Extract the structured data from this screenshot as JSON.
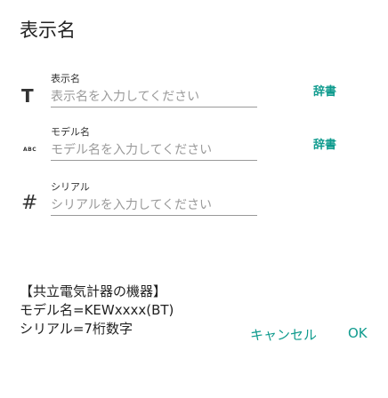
{
  "dialog": {
    "title": "表示名"
  },
  "fields": [
    {
      "icon": "text-format-icon",
      "icon_glyph": "T",
      "label": "表示名",
      "placeholder": "表示名を入力してください",
      "value": "",
      "dict_label": "辞書"
    },
    {
      "icon": "abc-icon",
      "icon_glyph": "ABC",
      "label": "モデル名",
      "placeholder": "モデル名を入力してください",
      "value": "",
      "dict_label": "辞書"
    },
    {
      "icon": "hash-icon",
      "icon_glyph": "#",
      "label": "シリアル",
      "placeholder": "シリアルを入力してください",
      "value": ""
    }
  ],
  "info": {
    "heading": "【共立電気計器の機器】",
    "model_line": "モデル名=KEWxxxx(BT)",
    "serial_line": "シリアル=7桁数字"
  },
  "buttons": {
    "cancel": "キャンセル",
    "ok": "OK"
  },
  "colors": {
    "accent": "#0f9b8e",
    "text": "#222222",
    "placeholder": "#9a9a9a"
  }
}
